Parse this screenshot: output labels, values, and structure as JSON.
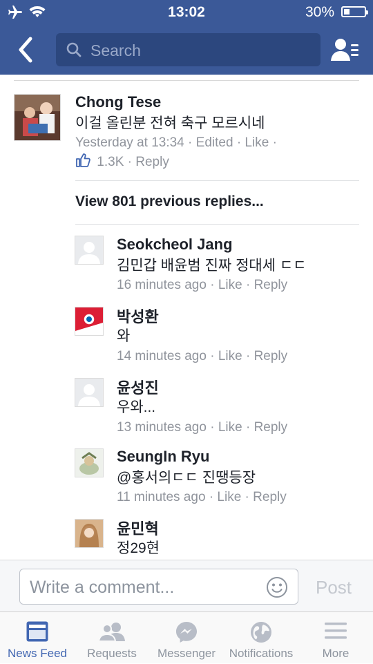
{
  "status_bar": {
    "time": "13:02",
    "battery": "30%",
    "battery_level": 0.3
  },
  "header": {
    "search_placeholder": "Search"
  },
  "parent_comment": {
    "author": "Chong Tese",
    "text": "이걸 올린분 전혀 축구 모르시네",
    "time": "Yesterday at 13:34",
    "edited": "Edited",
    "like_label": "Like",
    "like_count": "1.3K",
    "reply_label": "Reply"
  },
  "view_previous": "View 801 previous replies...",
  "replies": [
    {
      "author": "Seokcheol Jang",
      "text": "김민갑 배윤범 진짜 정대세 ㄷㄷ",
      "time": "16 minutes ago",
      "like_label": "Like",
      "reply_label": "Reply"
    },
    {
      "author": "박성환",
      "text": "와",
      "time": "14 minutes ago",
      "like_label": "Like",
      "reply_label": "Reply"
    },
    {
      "author": "윤성진",
      "text": "우와...",
      "time": "13 minutes ago",
      "like_label": "Like",
      "reply_label": "Reply"
    },
    {
      "author": "SeungIn Ryu",
      "text": "@홍서의ㄷㄷ 진땡등장",
      "time": "11 minutes ago",
      "like_label": "Like",
      "reply_label": "Reply"
    },
    {
      "author": "윤민혁",
      "text": "정29현",
      "time": "",
      "like_label": "",
      "reply_label": ""
    }
  ],
  "composer": {
    "placeholder": "Write a comment...",
    "post_label": "Post"
  },
  "tabs": [
    {
      "label": "News Feed",
      "icon": "news-feed-icon",
      "active": true
    },
    {
      "label": "Requests",
      "icon": "friend-requests-icon",
      "active": false
    },
    {
      "label": "Messenger",
      "icon": "messenger-icon",
      "active": false
    },
    {
      "label": "Notifications",
      "icon": "globe-icon",
      "active": false
    },
    {
      "label": "More",
      "icon": "hamburger-menu-icon",
      "active": false
    }
  ],
  "colors": {
    "brand": "#3b5998",
    "search_bg": "#2c477e",
    "meta": "#90949c",
    "active_tab": "#4267b2"
  }
}
